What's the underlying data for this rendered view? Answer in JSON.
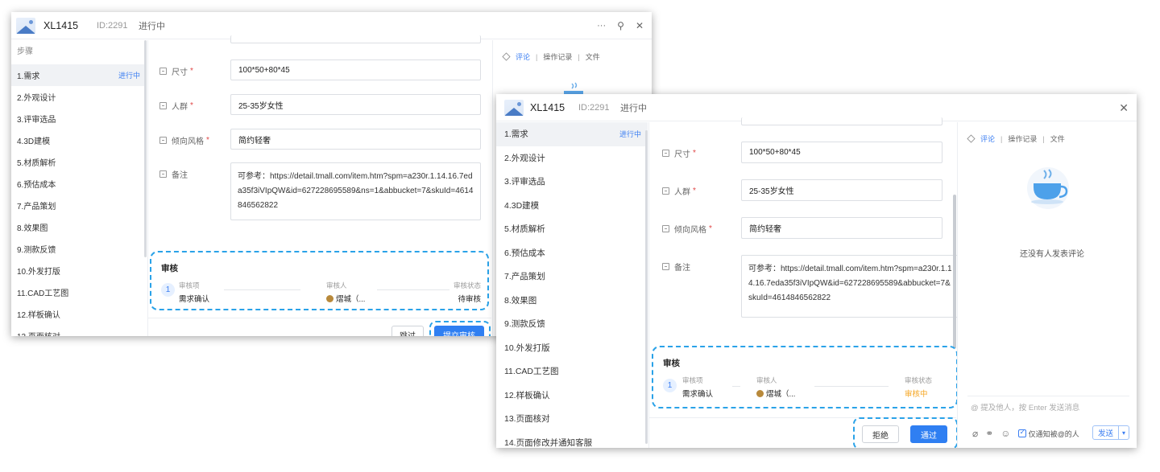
{
  "task": {
    "code": "XL1415",
    "id": "ID:2291",
    "status": "进行中"
  },
  "window_controls": {
    "more": "···",
    "tree": "⊥",
    "close": "✕"
  },
  "sidebar": {
    "heading": "步骤",
    "steps": [
      {
        "label": "1.需求",
        "status": "进行中"
      },
      {
        "label": "2.外观设计"
      },
      {
        "label": "3.评审选品"
      },
      {
        "label": "4.3D建模"
      },
      {
        "label": "5.材质解析"
      },
      {
        "label": "6.预估成本"
      },
      {
        "label": "7.产品策划"
      },
      {
        "label": "8.效果图"
      },
      {
        "label": "9.测款反馈"
      },
      {
        "label": "10.外发打版"
      },
      {
        "label": "11.CAD工艺图"
      },
      {
        "label": "12.样板确认"
      },
      {
        "label": "13.页面核对"
      },
      {
        "label": "14.页面修改并通知客服"
      }
    ]
  },
  "form": {
    "size": {
      "label": "尺寸",
      "value": "100*50+80*45"
    },
    "crowd": {
      "label": "人群",
      "value": "25-35岁女性"
    },
    "style": {
      "label": "倾向风格",
      "value": "简约轻奢"
    },
    "remark": {
      "label": "备注",
      "value_win1": "可参考：https://detail.tmall.com/item.htm?spm=a230r.1.14.16.7eda35f3iVIpQW&id=627228695589&ns=1&abbucket=7&skuId=4614846562822",
      "value_win2": "可参考：https://detail.tmall.com/item.htm?spm=a230r.1.14.16.7eda35f3iVIpQW&id=627228695589&abbucket=7&skuId=4614846562822"
    },
    "required_mark": "*"
  },
  "review": {
    "title": "审核",
    "index": "1",
    "item_key": "审核项",
    "item_value": "需求确认",
    "reviewer_key": "审核人",
    "reviewer_value": "熠城（...",
    "status_key": "审核状态",
    "status_win1": "待审核",
    "status_win2": "审核中",
    "status_color_win2": "#f5a623"
  },
  "buttons": {
    "skip": "跳过",
    "submit_review": "提交审核",
    "reject": "拒绝",
    "approve": "通过"
  },
  "comments": {
    "tabs": [
      "评论",
      "操作记录",
      "文件"
    ],
    "separator": "|",
    "empty": "还没有人发表评论",
    "placeholder": "@ 提及他人，按 Enter 发送消息",
    "notify_only": "仅通知被@的人",
    "send": "发送"
  },
  "colors": {
    "accent": "#3b7ef2",
    "dashed_highlight": "#2aa2e8",
    "pending": "#f5a623"
  }
}
